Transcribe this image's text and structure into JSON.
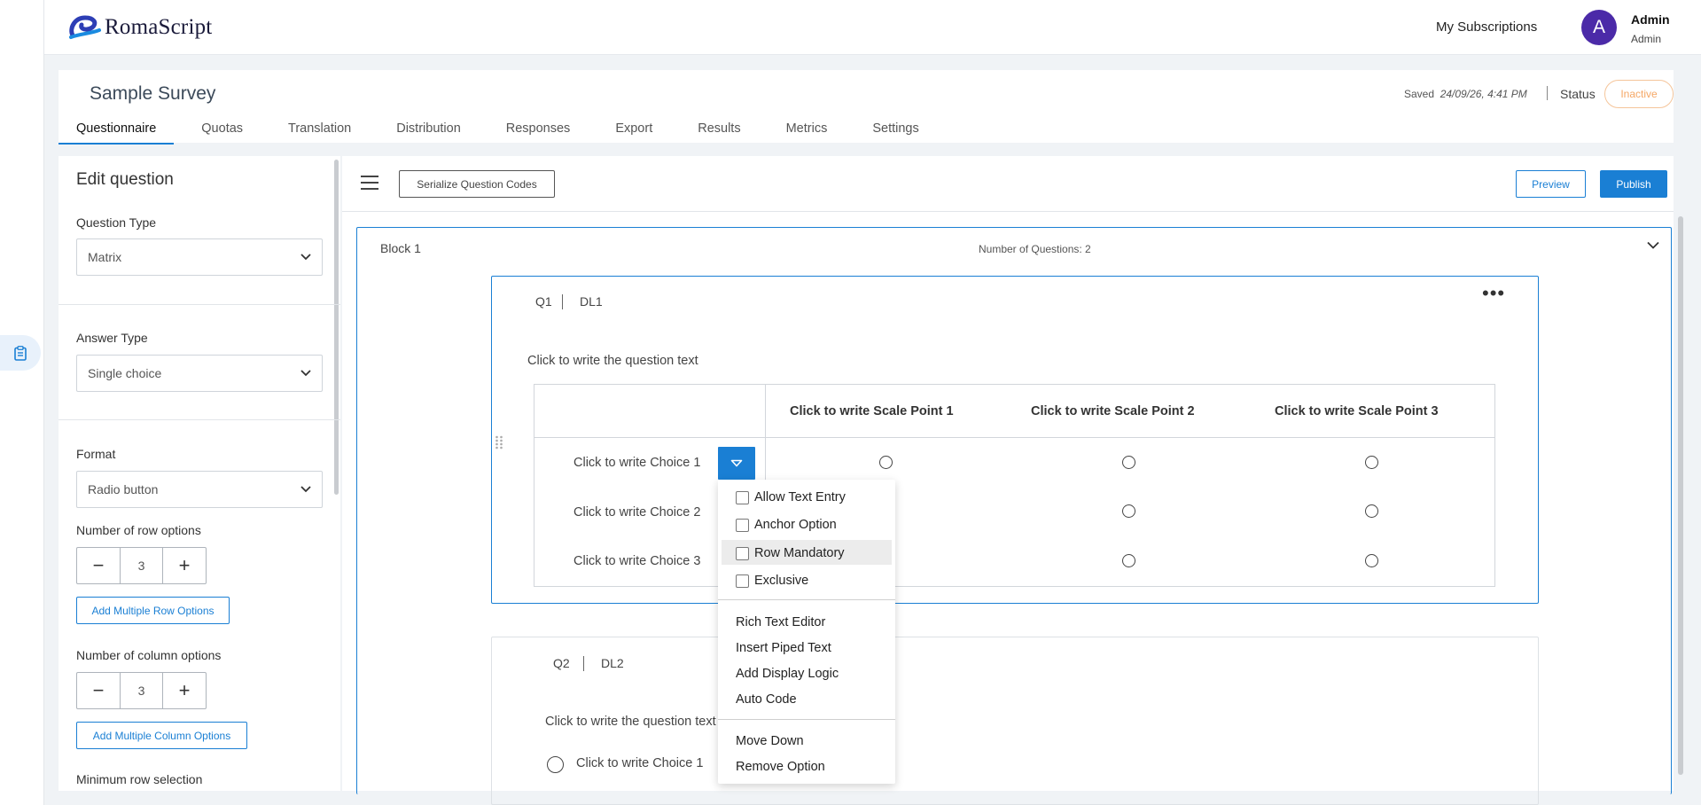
{
  "app": {
    "name": "RomaScript"
  },
  "topbar": {
    "subscriptions": "My Subscriptions",
    "avatar_initial": "A",
    "user_name": "Admin",
    "user_role": "Admin"
  },
  "survey": {
    "title": "Sample Survey",
    "saved_label": "Saved",
    "saved_time": "24/09/26, 4:41 PM",
    "status_label": "Status",
    "status_value": "Inactive",
    "tabs": [
      "Questionnaire",
      "Quotas",
      "Translation",
      "Distribution",
      "Responses",
      "Export",
      "Results",
      "Metrics",
      "Settings"
    ],
    "active_tab": "Questionnaire"
  },
  "edit_panel": {
    "heading": "Edit question",
    "question_type_label": "Question Type",
    "question_type_value": "Matrix",
    "answer_type_label": "Answer Type",
    "answer_type_value": "Single choice",
    "format_label": "Format",
    "format_value": "Radio button",
    "row_options_label": "Number of row options",
    "row_options_value": "3",
    "add_row_button": "Add Multiple Row Options",
    "col_options_label": "Number of column options",
    "col_options_value": "3",
    "add_col_button": "Add Multiple Column Options",
    "min_row_label": "Minimum row selection"
  },
  "toolbar": {
    "serialize": "Serialize Question Codes",
    "preview": "Preview",
    "publish": "Publish"
  },
  "block": {
    "title": "Block 1",
    "count": "Number of Questions: 2"
  },
  "q1": {
    "id": "Q1",
    "code": "DL1",
    "text": "Click to write the question text",
    "scale_points": [
      "Click to write Scale Point 1",
      "Click to write Scale Point 2",
      "Click to write Scale Point 3"
    ],
    "choices": [
      "Click to write Choice 1",
      "Click to write Choice 2",
      "Click to write Choice 3"
    ]
  },
  "q2": {
    "id": "Q2",
    "code": "DL2",
    "text": "Click to write the question text",
    "choices": [
      "Click to write Choice 1"
    ]
  },
  "menu": {
    "checks": [
      "Allow Text Entry",
      "Anchor Option",
      "Row Mandatory",
      "Exclusive"
    ],
    "highlighted": "Row Mandatory",
    "actions": [
      "Rich Text Editor",
      "Insert Piped Text",
      "Add Display Logic",
      "Auto Code"
    ],
    "moves": [
      "Move Down",
      "Remove Option"
    ]
  },
  "colors": {
    "accent": "#1a7fd4",
    "avatar": "#4b2aa8",
    "inactive": "#f5a765"
  },
  "icons": [
    "clipboard-icon",
    "chevron-down-icon",
    "minus-icon",
    "plus-icon",
    "hamburger-icon",
    "more-icon",
    "drag-handle-icon",
    "caret-down-icon"
  ]
}
